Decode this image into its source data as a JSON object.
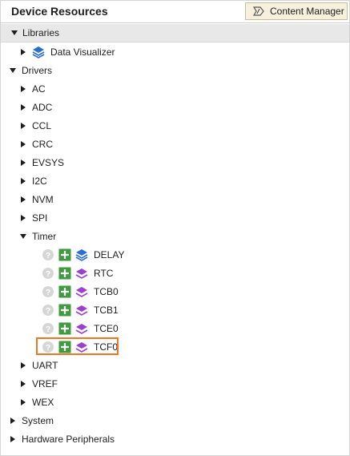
{
  "panel": {
    "title": "Device Resources",
    "content_manager_label": "Content Manager"
  },
  "tree": {
    "libraries": {
      "label": "Libraries",
      "expanded": true,
      "children": {
        "data_visualizer": "Data Visualizer"
      }
    },
    "drivers": {
      "label": "Drivers",
      "expanded": true,
      "items": {
        "ac": "AC",
        "adc": "ADC",
        "ccl": "CCL",
        "crc": "CRC",
        "evsys": "EVSYS",
        "i2c": "I2C",
        "nvm": "NVM",
        "spi": "SPI",
        "timer": {
          "label": "Timer",
          "expanded": true,
          "children": {
            "delay": "DELAY",
            "rtc": "RTC",
            "tcb0": "TCB0",
            "tcb1": "TCB1",
            "tce0": "TCE0",
            "tcf0": "TCF0"
          }
        },
        "uart": "UART",
        "vref": "VREF",
        "wex": "WEX"
      }
    },
    "system": "System",
    "hardware_peripherals": "Hardware Peripherals"
  },
  "colors": {
    "highlight": "#ec7724",
    "add_button": "#3f9b3f",
    "library_icon": "#2a6fd1",
    "driver_icon": "#9b3fd1"
  },
  "icons": {
    "expanded": "triangle-down",
    "collapsed": "triangle-right",
    "help": "question-circle-icon",
    "add": "plus-square-icon"
  }
}
